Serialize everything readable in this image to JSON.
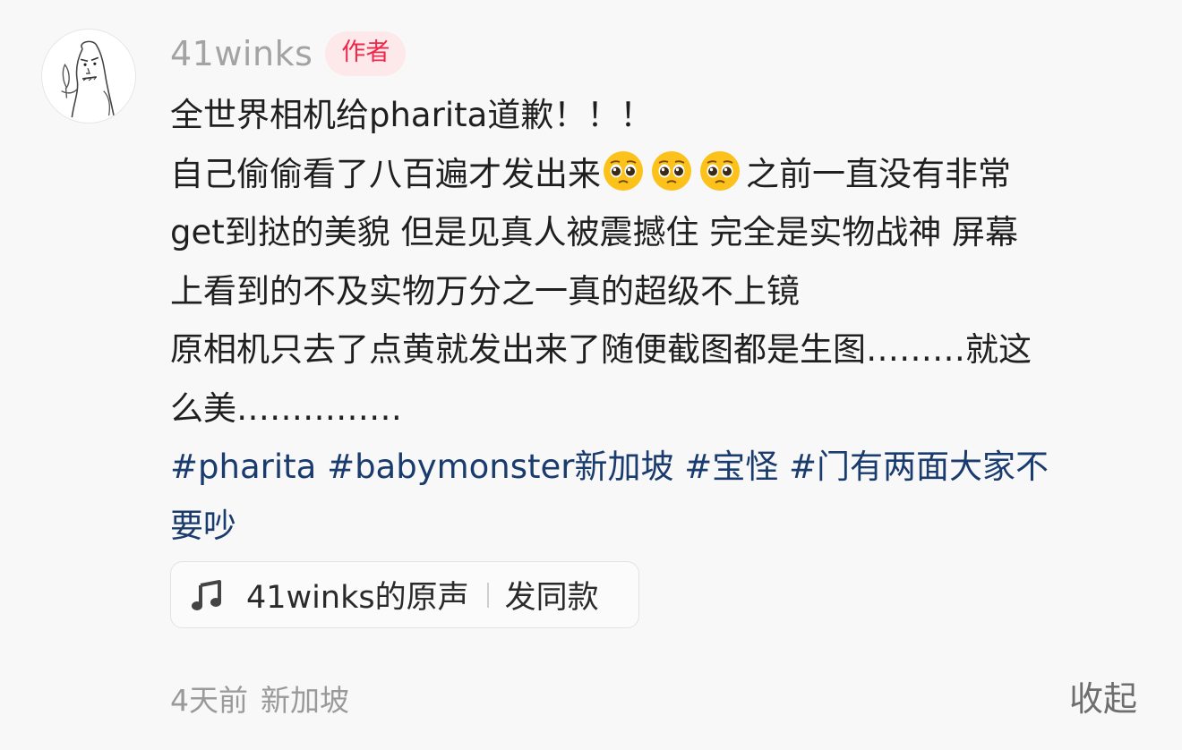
{
  "author": {
    "username": "41winks",
    "badge": "作者",
    "avatar_icon": "sketch-character-avatar"
  },
  "post": {
    "lines": [
      "全世界相机给pharita道歉！！！",
      "自己偷偷看了八百遍才发出来",
      "之前一直没有非常",
      "get到挞的美貌 但是见真人被震撼住 完全是实物战神 屏幕",
      "上看到的不及实物万分之一真的超级不上镜",
      "原相机只去了点黄就发出来了随便截图都是生图………就这",
      "么美……………"
    ],
    "emoji_icon": "pleading-face-emoji",
    "emoji_count": 3,
    "hashtags_line1": [
      "#pharita",
      "#babymonster新加坡",
      "#宝怪",
      "#门有两面大家不"
    ],
    "hashtags_line2": "要吵"
  },
  "music": {
    "icon": "music-note-icon",
    "name": "41winks的原声",
    "action": "发同款"
  },
  "meta": {
    "time": "4天前",
    "location": "新加坡"
  },
  "collapse_label": "收起",
  "colors": {
    "background": "#f8f8f8",
    "username": "#a3a3a3",
    "badge_text": "#f0264a",
    "badge_bg": "#fde8ea",
    "hashtag": "#1a3b6e",
    "body_text": "#1f1f1f"
  }
}
